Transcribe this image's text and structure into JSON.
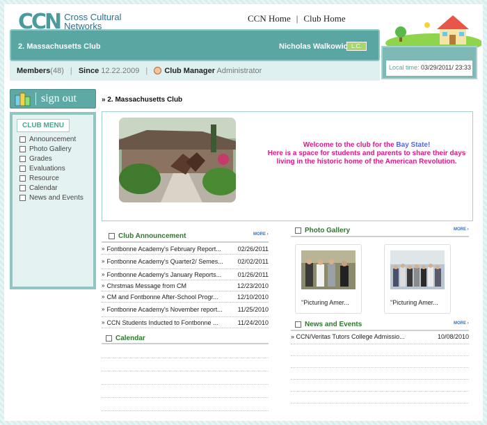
{
  "header": {
    "logo_mark": "CCN",
    "logo_line1": "Cross Cultural",
    "logo_line2": "Networks",
    "nav_home": "CCN Home",
    "nav_club_home": "Club Home",
    "nav_sep": "|"
  },
  "clubbar": {
    "club_name": "2. Massachusetts Club",
    "user_name": "Nicholas Walkowicz",
    "badge": "L.C."
  },
  "info": {
    "members_label": "Members",
    "members_count": "(48)",
    "since_label": "Since",
    "since_date": "12.22.2009",
    "manager_label": "Club Manager",
    "manager_name": "Administrator"
  },
  "time": {
    "label": "Local time:",
    "value": "03/29/2011/ 23:33"
  },
  "sidebar": {
    "signout": "sign out",
    "menu_title": "CLUB MENU",
    "items": [
      {
        "label": "Announcement"
      },
      {
        "label": "Photo Gallery"
      },
      {
        "label": "Grades"
      },
      {
        "label": "Evaluations"
      },
      {
        "label": "Resource"
      },
      {
        "label": "Calendar"
      },
      {
        "label": "News and Events"
      }
    ]
  },
  "main": {
    "breadcrumb": "2. Massachusetts Club",
    "welcome_pre": "Welcome to the club for the ",
    "welcome_bay": "Bay State!",
    "welcome_rest": "Here is a space for students and parents to share their days living in the historic home of the American Revolution."
  },
  "announcements": {
    "title": "Club Announcement",
    "more": "MORE",
    "rows": [
      {
        "title": "Fontbonne Academy's February Report...",
        "date": "02/26/2011"
      },
      {
        "title": "Fontbonne Academy's Quarter2/ Semes...",
        "date": "02/02/2011"
      },
      {
        "title": "Fontbonne Academy's January Reports...",
        "date": "01/26/2011"
      },
      {
        "title": "Chrstmas Message from CM",
        "date": "12/23/2010"
      },
      {
        "title": "CM and Fontbonne After-School Progr...",
        "date": "12/10/2010"
      },
      {
        "title": "Fontbonne Academy's November report...",
        "date": "11/25/2010"
      },
      {
        "title": "CCN Students Inducted to Fontbonne ...",
        "date": "11/24/2010"
      }
    ]
  },
  "calendar": {
    "title": "Calendar"
  },
  "gallery": {
    "title": "Photo Gallery",
    "more": "MORE",
    "items": [
      {
        "caption": "\"Picturing Amer..."
      },
      {
        "caption": "\"Picturing Amer..."
      }
    ]
  },
  "news": {
    "title": "News and Events",
    "more": "MORE",
    "rows": [
      {
        "title": "CCN/Veritas Tutors College Admissio...",
        "date": "10/08/2010"
      }
    ]
  }
}
